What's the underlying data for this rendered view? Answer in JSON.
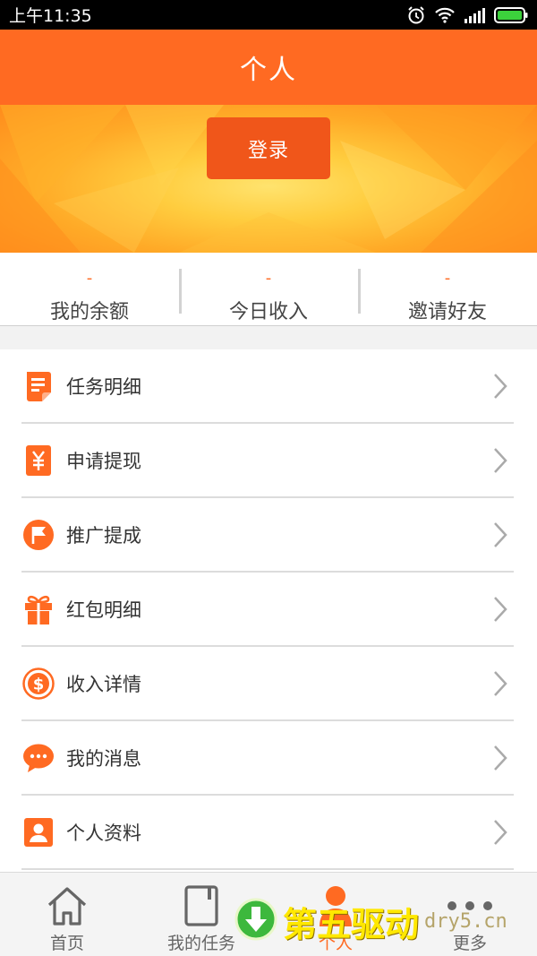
{
  "status_bar": {
    "time": "上午11:35",
    "icons": [
      "alarm-icon",
      "wifi-icon",
      "signal-icon",
      "battery-icon"
    ]
  },
  "header": {
    "title": "个人"
  },
  "banner": {
    "login_label": "登录"
  },
  "stats": [
    {
      "value": "-",
      "label": "我的余额"
    },
    {
      "value": "-",
      "label": "今日收入"
    },
    {
      "value": "-",
      "label": "邀请好友"
    }
  ],
  "menu": {
    "items": [
      {
        "label": "任务明细",
        "icon": "document-icon"
      },
      {
        "label": "申请提现",
        "icon": "yuan-icon"
      },
      {
        "label": "推广提成",
        "icon": "flag-icon"
      },
      {
        "label": "红包明细",
        "icon": "gift-icon"
      },
      {
        "label": "收入详情",
        "icon": "dollar-coin-icon"
      },
      {
        "label": "我的消息",
        "icon": "chat-bubble-icon"
      },
      {
        "label": "个人资料",
        "icon": "profile-icon"
      }
    ]
  },
  "bottom_nav": {
    "items": [
      {
        "label": "首页",
        "icon": "home-icon"
      },
      {
        "label": "我的任务",
        "icon": "tablet-icon"
      },
      {
        "label": "个人",
        "icon": "person-icon",
        "active": true
      },
      {
        "label": "更多",
        "icon": "more-dots-icon"
      }
    ]
  },
  "watermark": {
    "text": "第五驱动",
    "domain": "dry5.cn"
  },
  "colors": {
    "accent": "#ff6a22",
    "login_button": "#f0561a",
    "banner_light": "#ffe36e"
  }
}
